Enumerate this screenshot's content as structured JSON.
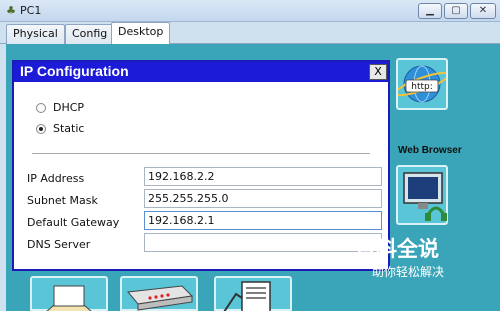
{
  "window": {
    "title": "PC1",
    "minimize": "▁",
    "maximize": "▢",
    "close": "✕"
  },
  "tabs": [
    {
      "label": "Physical"
    },
    {
      "label": "Config"
    },
    {
      "label": "Desktop",
      "selected": true
    }
  ],
  "dialog": {
    "title": "IP Configuration",
    "close_label": "X",
    "modes": [
      {
        "label": "DHCP",
        "checked": false
      },
      {
        "label": "Static",
        "checked": true
      }
    ],
    "fields": [
      {
        "label": "IP Address",
        "value": "192.168.2.2"
      },
      {
        "label": "Subnet Mask",
        "value": "255.255.255.0"
      },
      {
        "label": "Default Gateway",
        "value": "192.168.2.1"
      },
      {
        "label": "DNS Server",
        "value": ""
      }
    ]
  },
  "apps": {
    "web_browser": {
      "label": "Web Browser",
      "icon": "http-globe-icon",
      "icon_text": "http:"
    }
  },
  "watermark": {
    "title": "百科全说",
    "subtitle": "助你轻松解决"
  },
  "colors": {
    "desktop_bg": "#3aa4b8",
    "dialog_title_bg": "#1b1bd8",
    "tile_bg": "#59c5d6"
  }
}
